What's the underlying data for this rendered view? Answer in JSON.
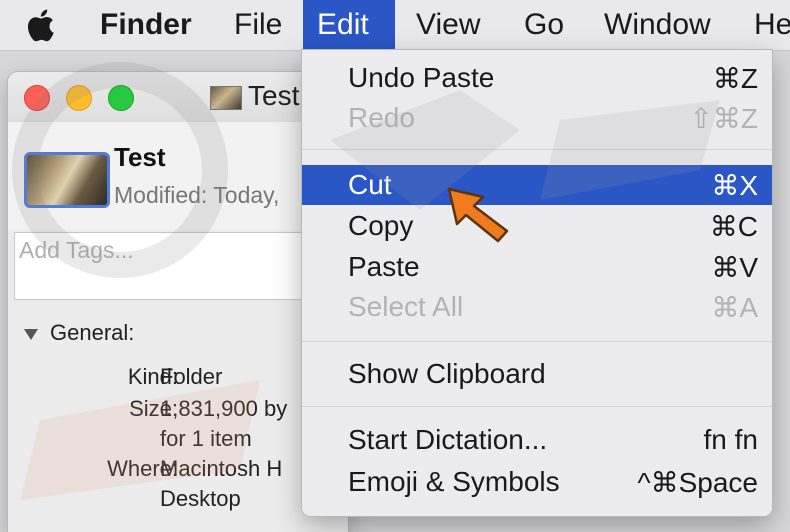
{
  "menubar": {
    "apple_icon": "apple-logo-icon",
    "items": [
      {
        "label": "Finder"
      },
      {
        "label": "File"
      },
      {
        "label": "Edit"
      },
      {
        "label": "View"
      },
      {
        "label": "Go"
      },
      {
        "label": "Window"
      },
      {
        "label": "He"
      }
    ],
    "active_item": "Edit",
    "highlight_color": "#2a56c6"
  },
  "info_window": {
    "title": "Test",
    "file_name": "Test",
    "modified": "Modified:  Today,",
    "tags_placeholder": "Add Tags...",
    "general_label": "General:",
    "rows": [
      {
        "label": "Kind:",
        "value": "Folder"
      },
      {
        "label": "Size:",
        "value": "1,831,900 by"
      },
      {
        "label": "",
        "value": "for 1 item"
      },
      {
        "label": "Where:",
        "value": "Macintosh H"
      },
      {
        "label": "",
        "value": "Desktop"
      }
    ],
    "traffic_lights": {
      "close": "#fe5f57",
      "minimize": "#febc2e",
      "zoom": "#28c840"
    }
  },
  "edit_menu": {
    "groups": [
      [
        {
          "label": "Undo Paste",
          "shortcut": "⌘Z",
          "enabled": true
        },
        {
          "label": "Redo",
          "shortcut": "⇧⌘Z",
          "enabled": false
        }
      ],
      [
        {
          "label": "Cut",
          "shortcut": "⌘X",
          "enabled": true,
          "highlighted": true
        },
        {
          "label": "Copy",
          "shortcut": "⌘C",
          "enabled": true
        },
        {
          "label": "Paste",
          "shortcut": "⌘V",
          "enabled": true
        },
        {
          "label": "Select All",
          "shortcut": "⌘A",
          "enabled": false
        }
      ],
      [
        {
          "label": "Show Clipboard",
          "shortcut": "",
          "enabled": true
        }
      ],
      [
        {
          "label": "Start Dictation...",
          "shortcut": "fn fn",
          "enabled": true
        },
        {
          "label": "Emoji & Symbols",
          "shortcut": "^⌘Space",
          "enabled": true
        }
      ]
    ]
  },
  "annotation": {
    "pointer_color": "#f07a1e",
    "pointer_icon": "arrow-pointer-icon"
  }
}
